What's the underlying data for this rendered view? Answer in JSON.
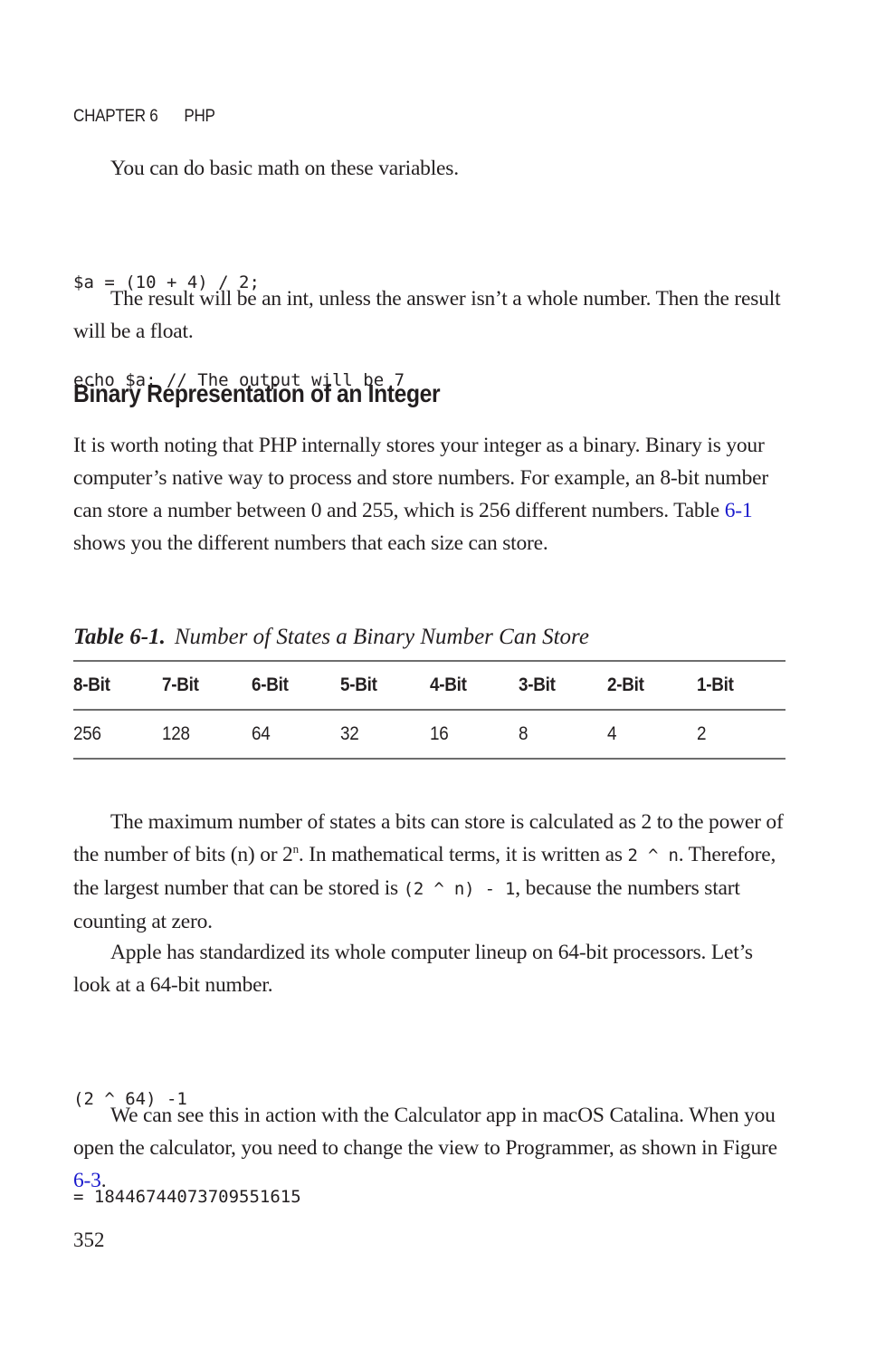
{
  "running_head": {
    "chapter": "CHAPTER 6",
    "title": "PHP"
  },
  "paragraphs": {
    "p1": "You can do basic math on these variables.",
    "p2": "The result will be an int, unless the answer isn’t a whole number. Then the result will be a float.",
    "p3": "It is worth noting that PHP internally stores your integer as a binary. Binary is your computer’s native way to process and store numbers. For example, an 8-bit number can store a number between 0 and 255, which is 256 different numbers. Table ",
    "p3_link": "6-1",
    "p3_end": " shows you the different numbers that each size can store.",
    "p4_a": "The maximum number of states a bits can store is calculated as 2 to the power of the number of bits (n) or 2",
    "p4_sup": "n",
    "p4_b": ". In mathematical terms, it is written as ",
    "p4_code1": "2 ^ n",
    "p4_c": ". Therefore, the largest number that can be stored is ",
    "p4_code2": "(2 ^ n) - 1",
    "p4_d": ", because the numbers start counting at zero.",
    "p5": "Apple has standardized its whole computer lineup on 64-bit processors. Let’s look at a 64-bit number.",
    "p6": "We can see this in action with the Calculator app in macOS Catalina. When you open the calculator, you need to change the view to Programmer, as shown in Figure ",
    "p6_link": "6-3",
    "p6_end": "."
  },
  "code_blocks": {
    "math": [
      "$a = (10 + 4) / 2;",
      "echo $a; // The output will be 7"
    ],
    "power": [
      "(2 ^ 64) -1",
      "= 18446744073709551615"
    ]
  },
  "section_heading": "Binary Representation of an Integer",
  "table": {
    "caption_label": "Table 6-1.",
    "caption_text": "Number of States a Binary Number Can Store",
    "headers": [
      "8-Bit",
      "7-Bit",
      "6-Bit",
      "5-Bit",
      "4-Bit",
      "3-Bit",
      "2-Bit",
      "1-Bit"
    ],
    "rows": [
      [
        "256",
        "128",
        "64",
        "32",
        "16",
        "8",
        "4",
        "2"
      ]
    ]
  },
  "page_number": "352",
  "colors": {
    "text": "#231f20",
    "link": "#1a1acd",
    "rule": "#6d6d6d"
  }
}
